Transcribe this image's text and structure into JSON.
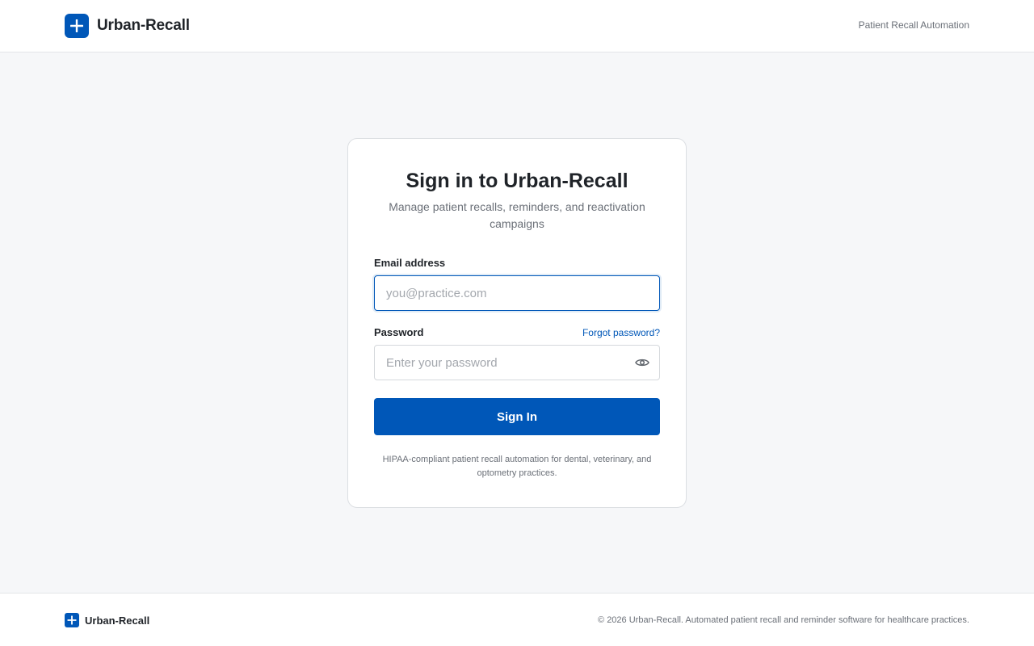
{
  "header": {
    "brand_name": "Urban-Recall",
    "tagline": "Patient Recall Automation"
  },
  "login": {
    "title": "Sign in to Urban-Recall",
    "subtitle": "Manage patient recalls, reminders, and reactivation campaigns",
    "email": {
      "label": "Email address",
      "placeholder": "you@practice.com",
      "value": ""
    },
    "password": {
      "label": "Password",
      "placeholder": "Enter your password",
      "value": "",
      "forgot_label": "Forgot password?"
    },
    "submit_label": "Sign In",
    "note": "HIPAA-compliant patient recall automation for dental, veterinary, and optometry practices."
  },
  "footer": {
    "brand_name": "Urban-Recall",
    "copyright": "© 2026 Urban-Recall. Automated patient recall and reminder software for healthcare practices."
  },
  "icons": {
    "logo": "plus-icon",
    "password_toggle": "eye-icon"
  },
  "colors": {
    "brand": "#0057b8",
    "background": "#f6f7f9",
    "text": "#1f2328",
    "muted": "#6b7078"
  }
}
